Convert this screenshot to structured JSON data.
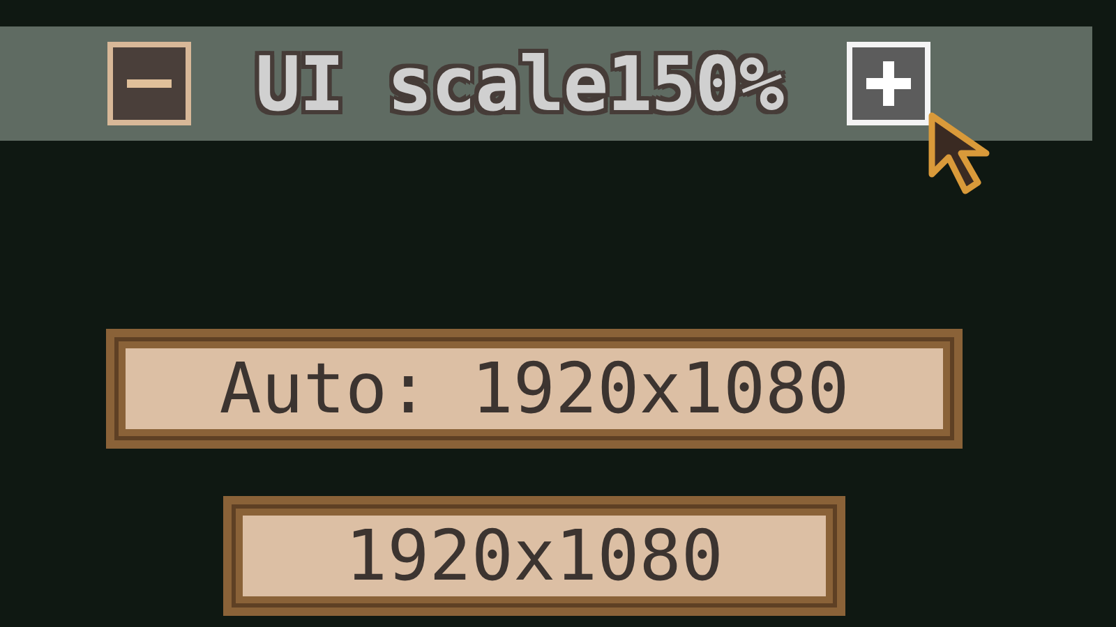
{
  "scale_bar": {
    "label": "UI scale150%",
    "buttons": [
      {
        "kind": "minus",
        "hovered": false
      },
      {
        "kind": "plus",
        "hovered": true
      }
    ]
  },
  "resolution_options": [
    {
      "label": "Auto: 1920x1080"
    },
    {
      "label": "1920x1080"
    }
  ]
}
